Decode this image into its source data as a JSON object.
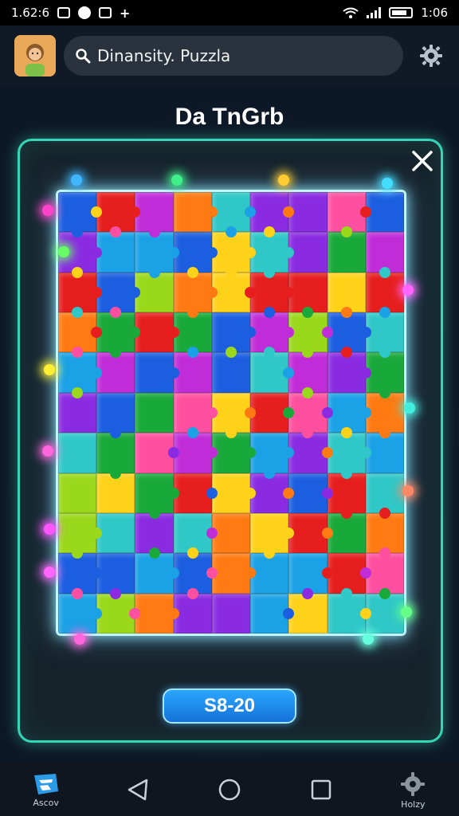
{
  "status_bar": {
    "time_left": "1.62:6",
    "time_right": "1:06"
  },
  "header": {
    "search_text": "Dinansity. Puzzla",
    "search_icon": "search-icon",
    "settings_icon": "gear-icon",
    "avatar": "avatar-icon"
  },
  "game": {
    "title": "Da TnGrb",
    "close_icon": "close-icon",
    "score_label": "S8-20",
    "board": {
      "columns": 9,
      "rows": 11,
      "palette": [
        "#e61e1e",
        "#ff7a12",
        "#ffd21a",
        "#19a93a",
        "#1aa1e6",
        "#1b5ee0",
        "#8a2be2",
        "#c02cd8",
        "#ff4fa0",
        "#9ad81c",
        "#2fc7c7"
      ]
    }
  },
  "navbar": {
    "left_label": "Ascov",
    "right_label": "Holzy"
  },
  "colors": {
    "panel_border": "#35d6b8",
    "board_glow": "#bff6ff",
    "accent_button": "#1e88e5"
  }
}
